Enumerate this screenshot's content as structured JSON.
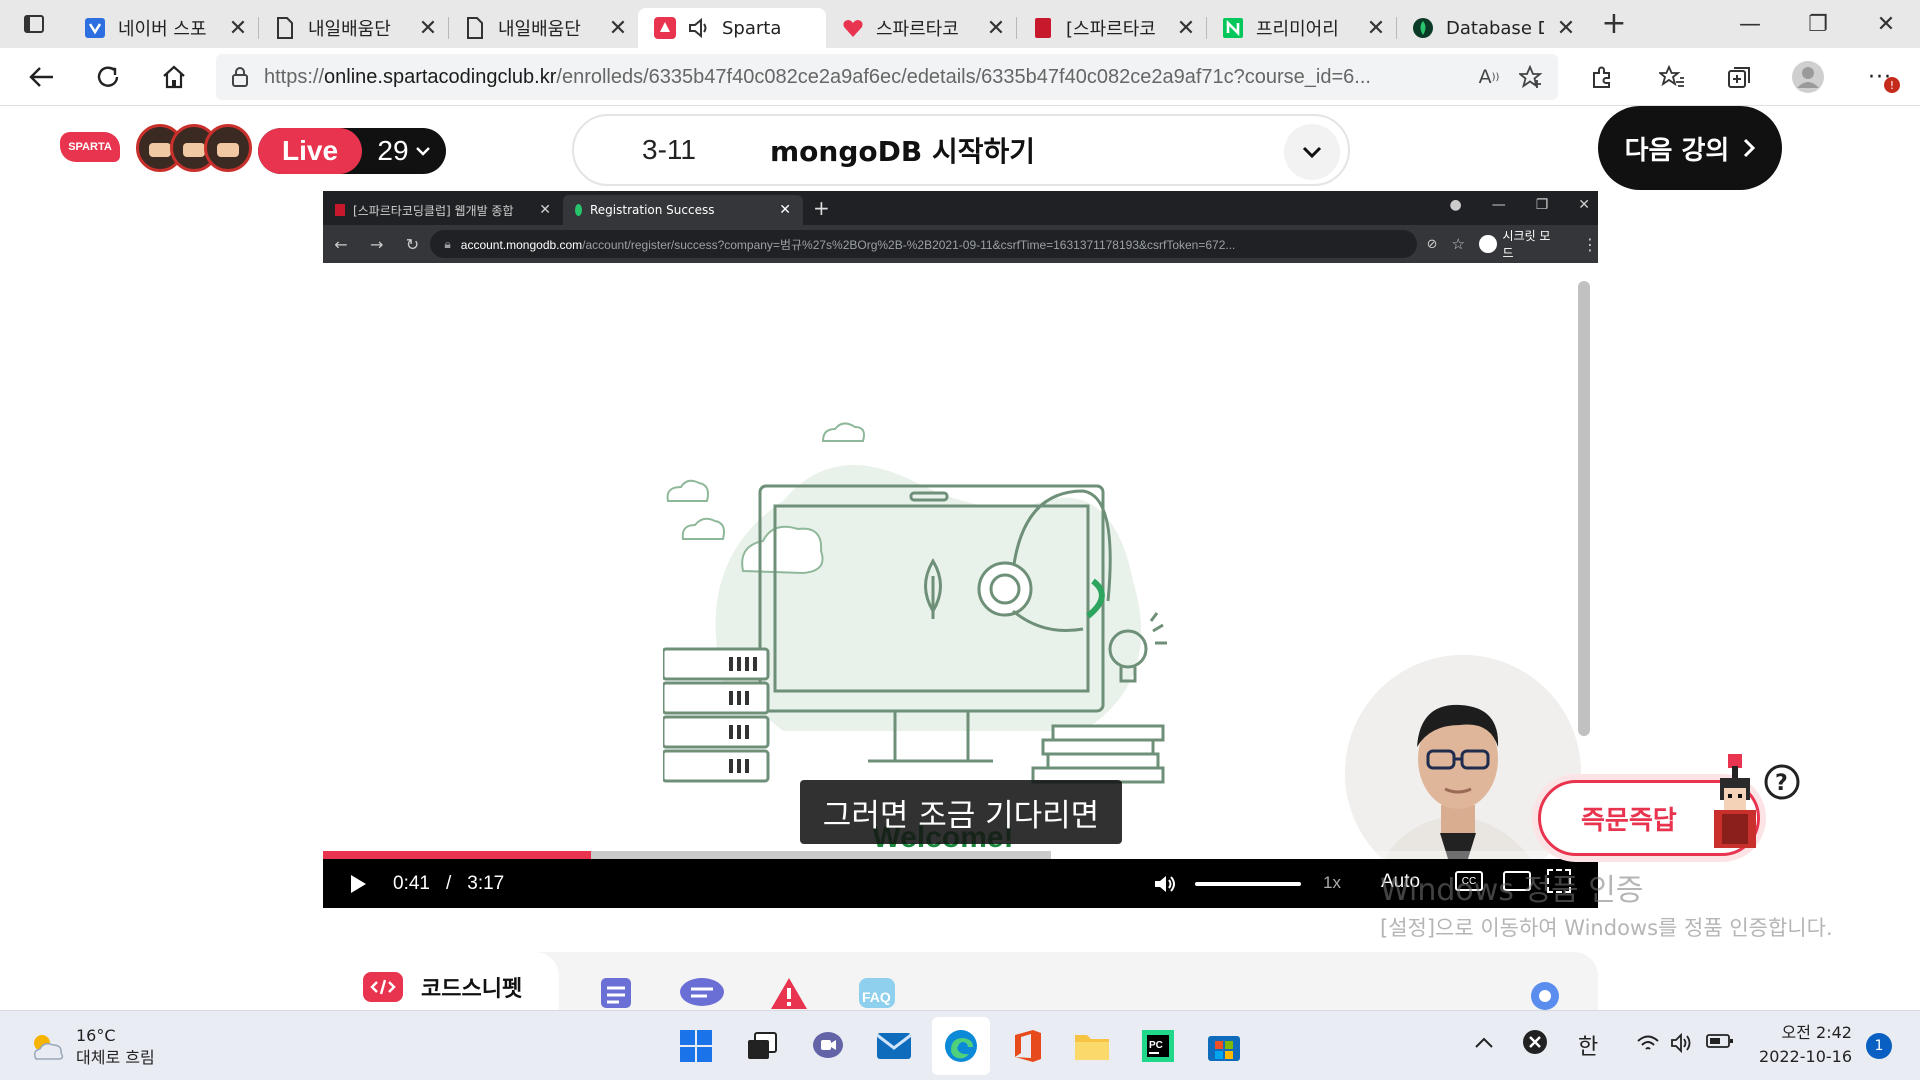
{
  "browser": {
    "tabs": [
      {
        "label": "네이버 스포",
        "icon": "naver-sports-icon"
      },
      {
        "label": "내일배움단",
        "icon": "document-icon"
      },
      {
        "label": "내일배움단",
        "icon": "document-icon"
      },
      {
        "label": "Sparta",
        "icon": "sparta-icon"
      },
      {
        "label": "스파르타코",
        "icon": "sparta-heart-icon"
      },
      {
        "label": "[스파르타코",
        "icon": "red-book-icon"
      },
      {
        "label": "프리미어리",
        "icon": "naver-icon"
      },
      {
        "label": "Database D",
        "icon": "mongodb-leaf-icon"
      }
    ],
    "close_glyph": "✕",
    "url_scheme": "https://",
    "url_host": "online.spartacodingclub.kr",
    "url_path": "/enrolleds/6335b47f40c082ce2a9af6ec/edetails/6335b47f40c082ce2a9af71c?course_id=6..."
  },
  "header": {
    "logo_text": "SPARTA",
    "live_label": "Live",
    "live_count": "29",
    "lecture_number": "3-11",
    "lecture_title": "mongoDB 시작하기",
    "next_button": "다음 강의"
  },
  "player": {
    "inner_tabs": [
      {
        "label": "[스파르타코딩클럽] 웹개발 종합"
      },
      {
        "label": "Registration Success"
      }
    ],
    "inner_url_host": "account.mongodb.com",
    "inner_url_path": "/account/register/success?company=범규%27s%2BOrg%2B-%2B2021-09-11&csrfTime=1631371178193&csrfToken=672...",
    "incognito_label": "시크릿 모드",
    "welcome_text": "Welcome!",
    "subtitle": "그러면 조금 기다리면",
    "current_time": "0:41",
    "separator": "/",
    "duration": "3:17",
    "progress_fraction": 0.21,
    "speed": "1x",
    "quality": "Auto"
  },
  "qna": {
    "label": "즉문즉답"
  },
  "watermark": {
    "line1": "Windows 정품 인증",
    "line2": "[설정]으로 이동하여 Windows를 정품 인증합니다."
  },
  "tools": {
    "snippet_label": "코드스니펫",
    "faq_label": "FAQ"
  },
  "taskbar": {
    "temperature": "16°C",
    "weather": "대체로 흐림",
    "ime": "한",
    "time": "오전 2:42",
    "date": "2022-10-16",
    "notifications": "1"
  },
  "colors": {
    "brand": "#e8344e",
    "mongodb_green": "#1b8a3f",
    "player_bg": "#000000"
  }
}
